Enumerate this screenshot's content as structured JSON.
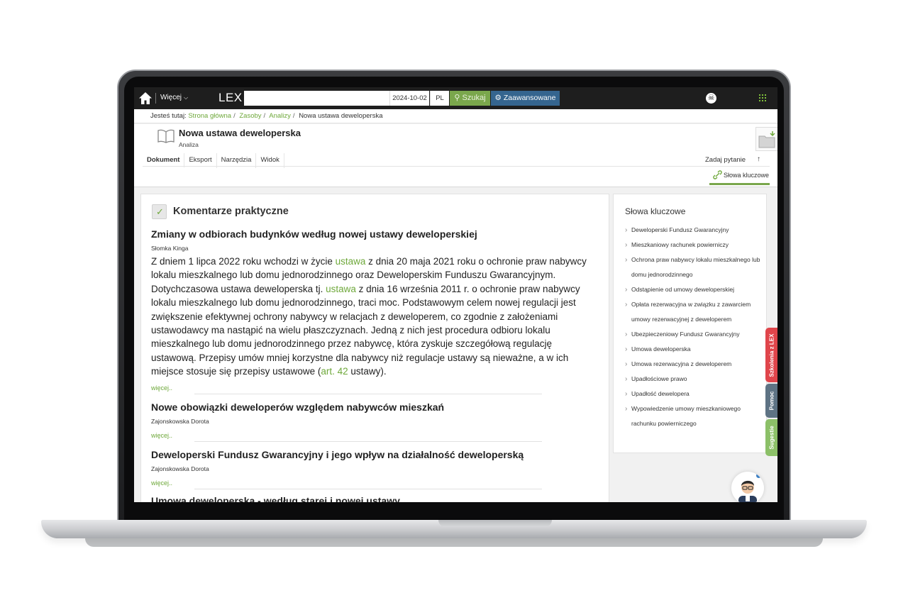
{
  "topbar": {
    "more_label": "Więcej",
    "logo": "LEX",
    "search_placeholder": "",
    "date": "2024-10-02",
    "lang": "PL",
    "search_label": "Szukaj",
    "advanced_label": "Zaawansowane",
    "accessibility_icon": "accessibility-icon",
    "apps_icon": "apps-grid-icon"
  },
  "breadcrumb": {
    "prefix": "Jesteś tutaj:",
    "items": [
      "Strona główna",
      "Zasoby",
      "Analizy",
      "Nowa ustawa deweloperska"
    ]
  },
  "document": {
    "title": "Nowa ustawa deweloperska",
    "type": "Analiza",
    "tabs": [
      "Dokument",
      "Eksport",
      "Narzędzia",
      "Widok"
    ],
    "ask_label": "Zadaj pytanie",
    "up_icon": "↑",
    "keywords_tab": "Słowa kluczowe"
  },
  "main": {
    "section_title": "Komentarze praktyczne",
    "articles": [
      {
        "title": "Zmiany w odbiorach budynków według nowej ustawy deweloperskiej",
        "author": "Słomka Kinga",
        "body_1": "Z dniem 1 lipca 2022 roku wchodzi w życie ",
        "link_1": "ustawa",
        "body_2": " z dnia 20 maja 2021 roku o ochronie praw nabywcy lokalu mieszkalnego lub domu jednorodzinnego oraz Deweloperskim Funduszu Gwarancyjnym. Dotychczasowa ustawa deweloperska tj. ",
        "link_2": "ustawa",
        "body_3": " z dnia 16 września 2011 r. o ochronie praw nabywcy lokalu mieszkalnego lub domu jednorodzinnego, traci moc. Podstawowym celem nowej regulacji jest zwiększenie efektywnej ochrony nabywcy w relacjach z deweloperem, co zgodnie z założeniami ustawodawcy ma nastąpić na wielu płaszczyznach. Jedną z nich jest procedura odbioru lokalu mieszkalnego lub domu jednorodzinnego przez nabywcę, która zyskuje szczegółową regulację ustawową. Przepisy umów mniej korzystne dla nabywcy niż regulacje ustawy są nieważne, a w ich miejsce stosuje się przepisy ustawowe (",
        "link_3": "art. 42",
        "body_4": " ustawy).",
        "more": "więcej.."
      },
      {
        "title": "Nowe obowiązki deweloperów względem nabywców mieszkań",
        "author": "Zajonskowska Dorota",
        "more": "więcej.."
      },
      {
        "title": "Deweloperski Fundusz Gwarancyjny i jego wpływ na działalność deweloperską",
        "author": "Zajonskowska Dorota",
        "more": "więcej.."
      },
      {
        "title": "Umowa deweloperska - według starej i nowej ustawy"
      }
    ]
  },
  "keywords": {
    "title": "Słowa kluczowe",
    "items": [
      "Deweloperski Fundusz Gwarancyjny",
      "Mieszkaniowy rachunek powierniczy",
      "Ochrona praw nabywcy lokalu mieszkalnego lub domu jednorodzinnego",
      "Odstąpienie od umowy deweloperskiej",
      "Opłata rezerwacyjna w związku z zawarciem umowy rezerwacyjnej z deweloperem",
      "Ubezpieczeniowy Fundusz Gwarancyjny",
      "Umowa deweloperska",
      "Umowa rezerwacyjna z deweloperem",
      "Upadłościowe prawo",
      "Upadłość dewelopera",
      "Wypowiedzenie umowy mieszkaniowego rachunku powierniczego"
    ]
  },
  "side_tabs": {
    "training": "Szkolenia z LEX",
    "help": "Pomoc",
    "suggestions": "Sugestie"
  },
  "colors": {
    "accent_green": "#6ea83a",
    "search_green": "#7aa74c",
    "advanced_blue": "#35658f",
    "training_red": "#e0454b",
    "help_slate": "#5e7384",
    "suggest_green": "#8cc068"
  }
}
